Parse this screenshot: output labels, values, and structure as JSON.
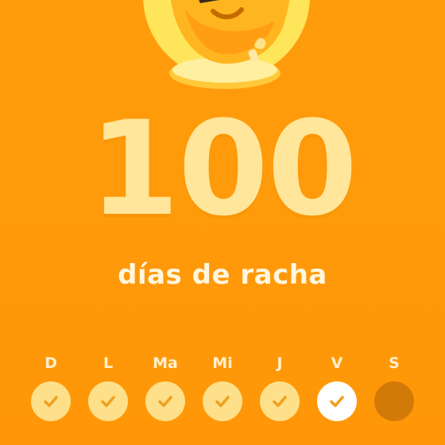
{
  "streak": {
    "count": "100",
    "label": "días de racha"
  },
  "week": {
    "days": [
      {
        "label": "D",
        "status": "completed"
      },
      {
        "label": "L",
        "status": "completed"
      },
      {
        "label": "Ma",
        "status": "completed"
      },
      {
        "label": "Mi",
        "status": "completed"
      },
      {
        "label": "J",
        "status": "completed"
      },
      {
        "label": "V",
        "status": "today-completed"
      },
      {
        "label": "S",
        "status": "pending"
      }
    ]
  },
  "colors": {
    "background": "#FF9A0A",
    "number": "#FFE69A",
    "completed_dot": "#FFE08A",
    "today_dot": "#FFFFFF",
    "pending_dot": "#D27A08",
    "check": "#F0A020"
  },
  "icons": {
    "mascot": "flame-mascot-sunglasses",
    "day_check": "check-icon"
  }
}
